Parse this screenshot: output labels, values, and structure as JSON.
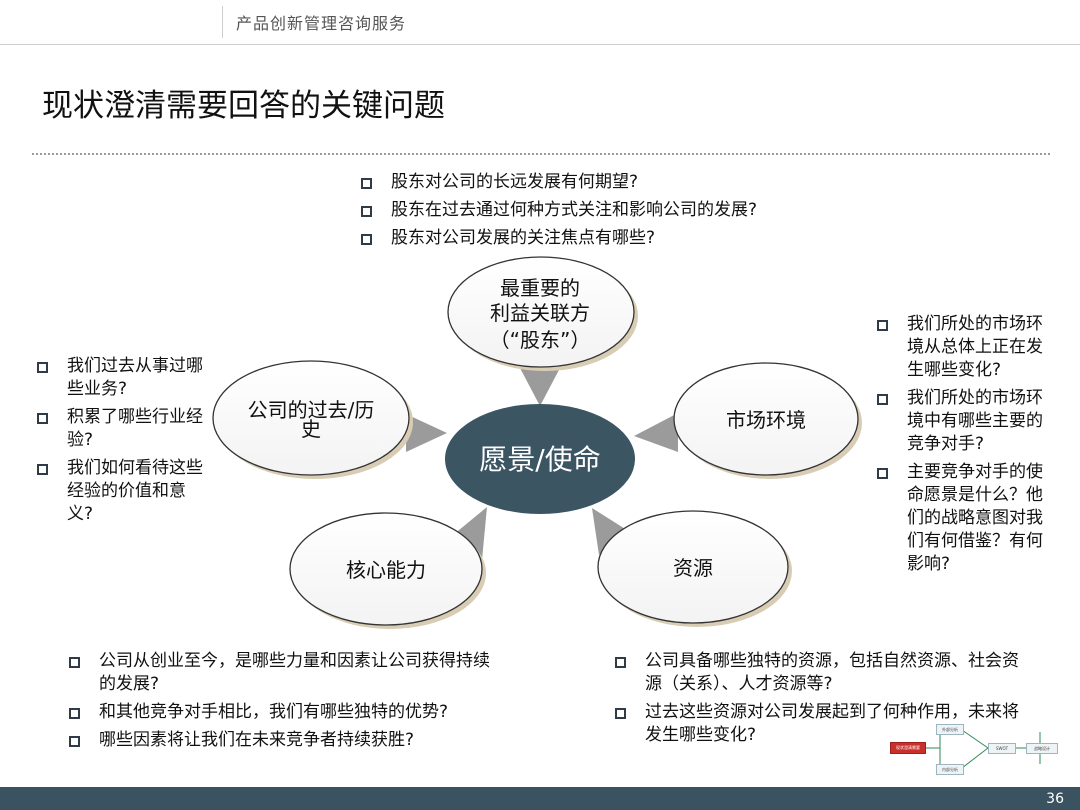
{
  "header": {
    "text": "产品创新管理咨询服务"
  },
  "page_title": "现状澄清需要回答的关键问题",
  "diagram": {
    "center": "愿景/使命",
    "shareholders": {
      "line1": "最重要的",
      "line2": "利益关联方",
      "line3": "（“股东”）"
    },
    "history": {
      "line1": "公司的过去/历",
      "line2": "史"
    },
    "market": "市场环境",
    "core": "核心能力",
    "resources": "资源"
  },
  "questions": {
    "shareholders": [
      "股东对公司的长远发展有何期望?",
      "股东在过去通过何种方式关注和影响公司的发展?",
      "股东对公司发展的关注焦点有哪些?"
    ],
    "history": [
      "我们过去从事过哪些业务?",
      "积累了哪些行业经验?",
      "我们如何看待这些经验的价值和意义?"
    ],
    "market": [
      "我们所处的市场环境从总体上正在发生哪些变化?",
      "我们所处的市场环境中有哪些主要的竞争对手?",
      "主要竞争对手的使命愿景是什么？他们的战略意图对我们有何借鉴？有何影响?"
    ],
    "core": [
      "公司从创业至今，是哪些力量和因素让公司获得持续的发展?",
      "和其他竞争对手相比，我们有哪些独特的优势?",
      "哪些因素将让我们在未来竞争者持续获胜?"
    ],
    "resources": [
      "公司具备哪些独特的资源，包括自然资源、社会资源（关系）、人才资源等?",
      "过去这些资源对公司发展起到了何种作用，未来将发生哪些变化?"
    ]
  },
  "thumbnail": {
    "start": "现状澄清需要",
    "top": "外部分析",
    "bottom": "内部分析",
    "mid": "SWOT",
    "end": "战略设计"
  },
  "footer": {
    "page_number": "36"
  },
  "colors": {
    "center_fill": "#3b5563",
    "footer": "#3b5360",
    "arrow": "#9b9b9b"
  }
}
